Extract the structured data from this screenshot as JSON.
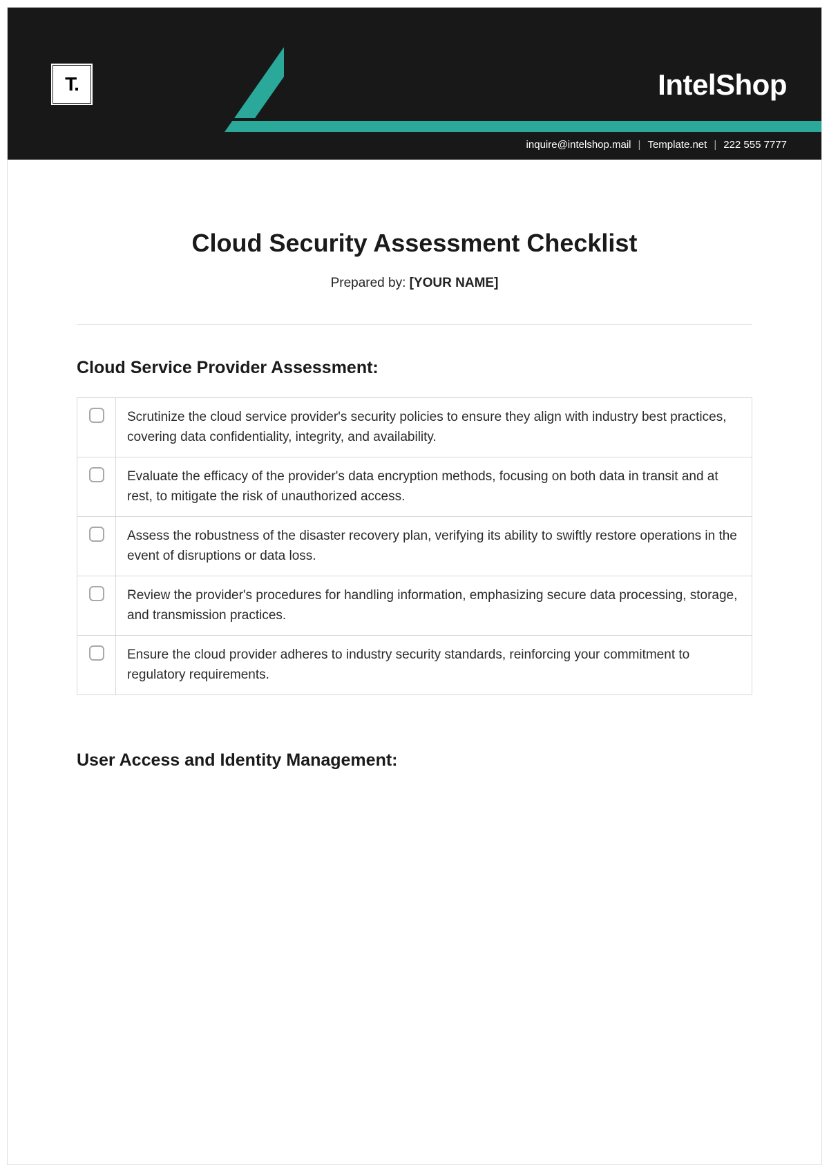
{
  "header": {
    "logo_text": "T.",
    "company_name": "IntelShop",
    "contact_email": "inquire@intelshop.mail",
    "contact_site": "Template.net",
    "contact_phone": "222 555 7777"
  },
  "document": {
    "title": "Cloud Security Assessment Checklist",
    "prepared_by_label": "Prepared by: ",
    "prepared_by_value": "[YOUR NAME]"
  },
  "sections": [
    {
      "title": "Cloud Service Provider Assessment:",
      "items": [
        "Scrutinize the cloud service provider's security policies to ensure they align with industry best practices, covering data confidentiality, integrity, and availability.",
        "Evaluate the efficacy of the provider's data encryption methods, focusing on both data in transit and at rest, to mitigate the risk of unauthorized access.",
        "Assess the robustness of the disaster recovery plan, verifying its ability to swiftly restore operations in the event of disruptions or data loss.",
        "Review the provider's procedures for handling information, emphasizing secure data processing, storage, and transmission practices.",
        "Ensure the cloud provider adheres to industry security standards, reinforcing your commitment to regulatory requirements."
      ]
    },
    {
      "title": "User Access and Identity Management:",
      "items": []
    }
  ]
}
